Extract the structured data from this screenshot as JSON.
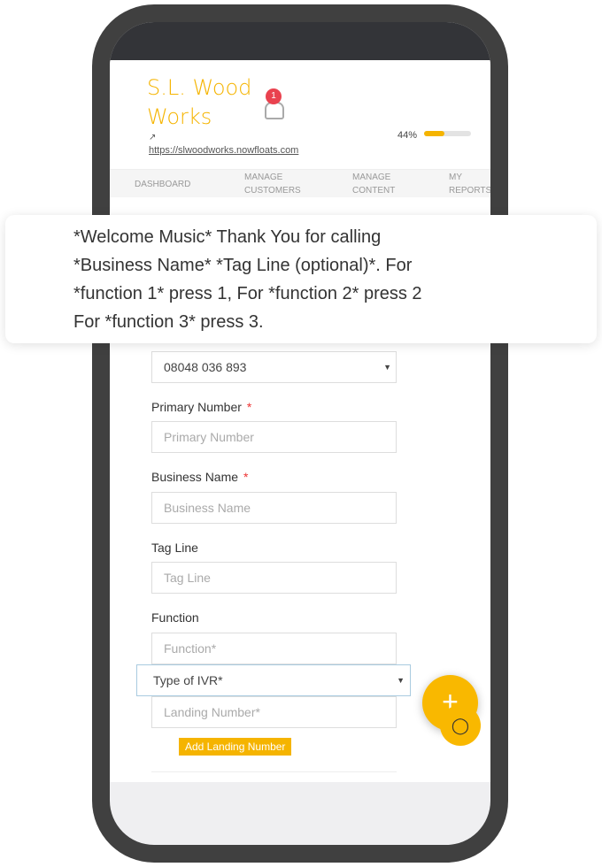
{
  "header": {
    "brand_line1": "S.L. Wood",
    "brand_line2": "Works",
    "notification_count": "1",
    "external_link_icon": "external-link-icon",
    "url": "https://slwoodworks.nowfloats.com",
    "progress_label": "44%",
    "progress_value": 44,
    "accent": "#f5b400"
  },
  "tabs": [
    {
      "label1": "DASHBOARD",
      "label2": ""
    },
    {
      "label1": "MANAGE",
      "label2": "CUSTOMERS"
    },
    {
      "label1": "MANAGE",
      "label2": "CONTENT"
    },
    {
      "label1": "MY",
      "label2": "REPORTS"
    }
  ],
  "popup": {
    "text": "*Welcome Music* Thank You for calling *Business Name* *Tag Line (optional)*. For *function 1* press 1, For *function 2* press 2 For *function 3* press 3."
  },
  "form": {
    "number_select": "08048 036 893",
    "primary_label": "Primary Number",
    "primary_placeholder": "Primary Number",
    "business_label": "Business Name",
    "business_placeholder": "Business Name",
    "tagline_label": "Tag Line",
    "tagline_placeholder": "Tag Line",
    "function_label": "Function",
    "function_placeholder": "Function*",
    "ivr_select": "Type of IVR*",
    "landing_placeholder": "Landing Number*",
    "add_landing": "Add Landing Number",
    "required_mark": "*"
  },
  "fab": {
    "plus": "+",
    "chat": "💬"
  }
}
